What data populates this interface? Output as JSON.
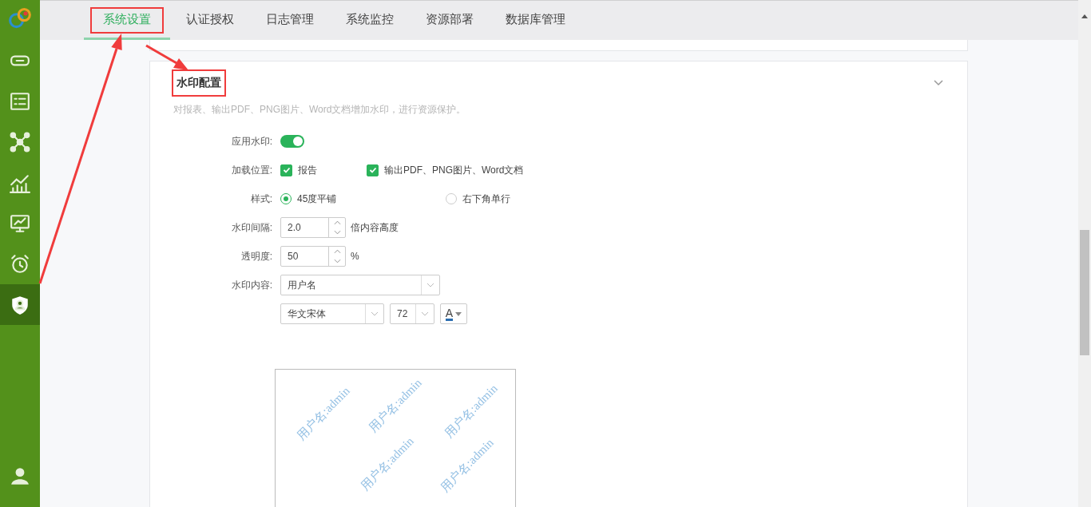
{
  "sidebar": {
    "items": [
      {
        "kind": "link",
        "selected": false
      },
      {
        "kind": "list",
        "selected": false
      },
      {
        "kind": "network",
        "selected": false
      },
      {
        "kind": "chart",
        "selected": false
      },
      {
        "kind": "screen",
        "selected": false
      },
      {
        "kind": "alarm",
        "selected": false
      },
      {
        "kind": "shield",
        "selected": true
      }
    ]
  },
  "tabs": [
    {
      "label": "系统设置",
      "selected": true,
      "annotated": true
    },
    {
      "label": "认证授权",
      "selected": false,
      "annotated": false
    },
    {
      "label": "日志管理",
      "selected": false,
      "annotated": false
    },
    {
      "label": "系统监控",
      "selected": false,
      "annotated": false
    },
    {
      "label": "资源部署",
      "selected": false,
      "annotated": false
    },
    {
      "label": "数据库管理",
      "selected": false,
      "annotated": false
    }
  ],
  "section": {
    "title": "水印配置",
    "annotated": true,
    "expanded": true,
    "description": "对报表、输出PDF、PNG图片、Word文档增加水印，进行资源保护。"
  },
  "form": [
    {
      "kind": "toggle",
      "label": "应用水印:",
      "on": true
    },
    {
      "kind": "checks",
      "label": "加载位置:",
      "options": [
        {
          "label": "报告",
          "checked": true
        },
        {
          "label": "输出PDF、PNG图片、Word文档",
          "checked": true
        }
      ]
    },
    {
      "kind": "radios",
      "label": "样式:",
      "options": [
        {
          "label": "45度平铺",
          "selected": true
        },
        {
          "label": "右下角单行",
          "selected": false
        }
      ]
    },
    {
      "kind": "spinner",
      "label": "水印间隔:",
      "value": "2.0",
      "unit": "倍内容高度"
    },
    {
      "kind": "spinner",
      "label": "透明度:",
      "value": "50",
      "unit": "%"
    },
    {
      "kind": "select",
      "label": "水印内容:",
      "value": "用户名"
    },
    {
      "kind": "font",
      "font": "华文宋体",
      "size": "72",
      "glyph": "A",
      "color": "#2a6db0"
    }
  ],
  "preview": {
    "texts": [
      "用户名:admin",
      "用户名:admin",
      "用户名:admin",
      "用户名:admin",
      "用户名:admin"
    ]
  }
}
